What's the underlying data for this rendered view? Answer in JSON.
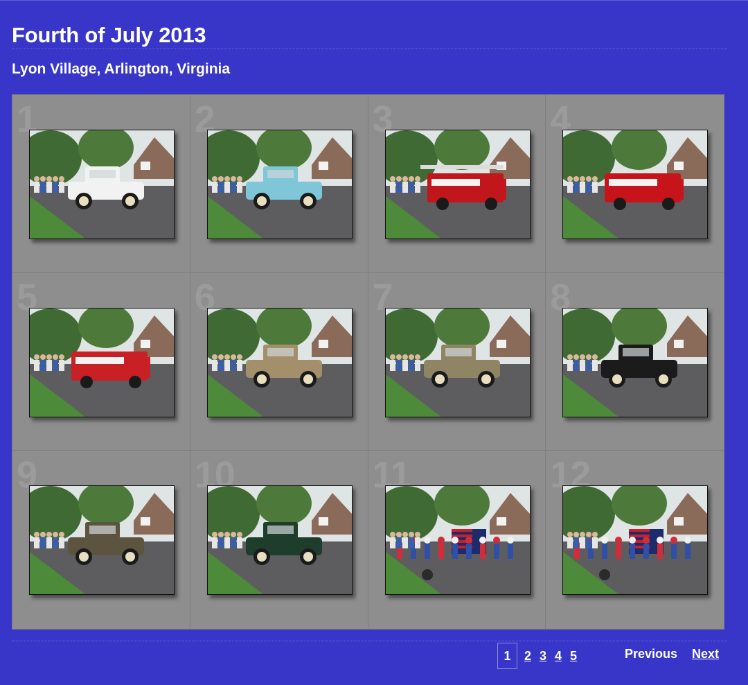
{
  "header": {
    "title": "Fourth of July 2013",
    "subtitle": "Lyon Village, Arlington, Virginia"
  },
  "gallery": {
    "items": [
      {
        "number": "1",
        "scene": "police-car",
        "accent": "#f2f2f2"
      },
      {
        "number": "2",
        "scene": "classic-car",
        "accent": "#7fc7d8"
      },
      {
        "number": "3",
        "scene": "ladder-truck",
        "accent": "#c0161c"
      },
      {
        "number": "4",
        "scene": "fire-engine",
        "accent": "#c7141b"
      },
      {
        "number": "5",
        "scene": "ambulance",
        "accent": "#c82025"
      },
      {
        "number": "6",
        "scene": "antique-car",
        "accent": "#a48f6b"
      },
      {
        "number": "7",
        "scene": "antique-car",
        "accent": "#8f8463"
      },
      {
        "number": "8",
        "scene": "model-t",
        "accent": "#1b1b1b"
      },
      {
        "number": "9",
        "scene": "touring-car",
        "accent": "#5d5440"
      },
      {
        "number": "10",
        "scene": "roadster",
        "accent": "#1f3d2c"
      },
      {
        "number": "11",
        "scene": "flag-parade",
        "accent": "#1d2b6b"
      },
      {
        "number": "12",
        "scene": "flag-parade",
        "accent": "#1d2b6b"
      }
    ]
  },
  "pagination": {
    "pages": [
      "1",
      "2",
      "3",
      "4",
      "5"
    ],
    "current": "1",
    "previous_label": "Previous",
    "next_label": "Next"
  },
  "colors": {
    "background": "#3836c8",
    "grid": "#8e8e8e"
  }
}
